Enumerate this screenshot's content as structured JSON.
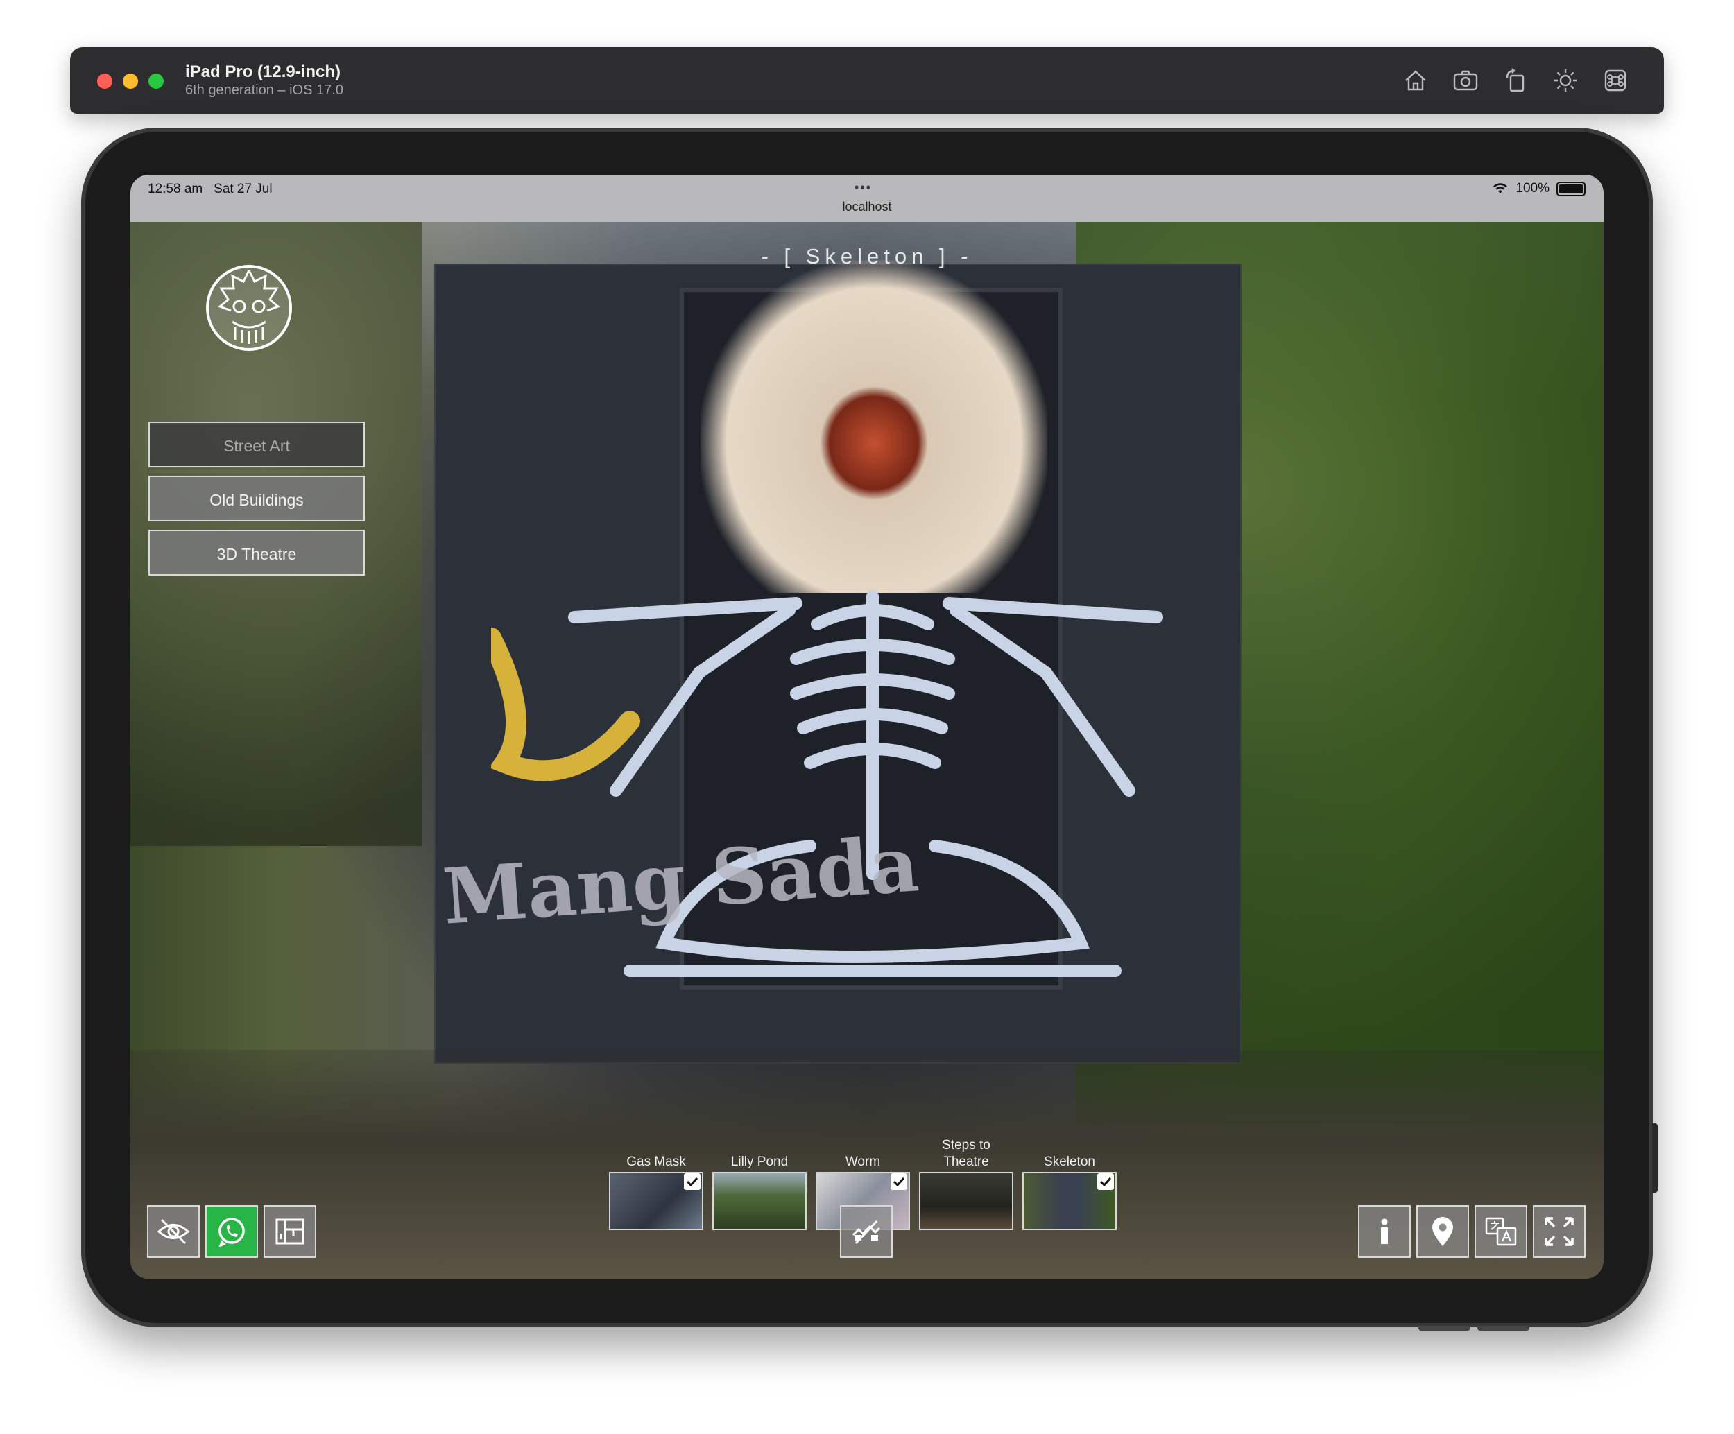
{
  "simulator": {
    "device_name": "iPad Pro (12.9-inch)",
    "device_subtitle": "6th generation – iOS 17.0",
    "toolbar_icons": [
      "home-icon",
      "screenshot-icon",
      "rotate-icon",
      "appearance-icon",
      "command-icon"
    ]
  },
  "status_bar": {
    "time": "12:58 am",
    "date": "Sat 27 Jul",
    "dots": "•••",
    "url": "localhost",
    "battery": "100%"
  },
  "tour": {
    "title": "- [ Skeleton ] -",
    "menu": [
      {
        "label": "Street Art",
        "active": true
      },
      {
        "label": "Old Buildings",
        "active": false
      },
      {
        "label": "3D Theatre",
        "active": false
      }
    ],
    "thumbnails": [
      {
        "label": "Gas Mask",
        "checked": true
      },
      {
        "label": "Lilly Pond",
        "checked": false
      },
      {
        "label": "Worm",
        "checked": true
      },
      {
        "label": "Steps to Theatre",
        "checked": false
      },
      {
        "label": "Skeleton",
        "checked": true
      }
    ],
    "graffiti_text": "Mang Sada",
    "bottom_left_buttons": [
      "hide-icon",
      "whatsapp-icon",
      "floorplan-icon"
    ],
    "bottom_center_button": "gyro-off-icon",
    "bottom_right_buttons": [
      "info-icon",
      "location-pin-icon",
      "translate-icon",
      "fullscreen-icon"
    ],
    "colors": {
      "whatsapp": "#28b446",
      "button_bg": "#8c8c8c"
    }
  }
}
